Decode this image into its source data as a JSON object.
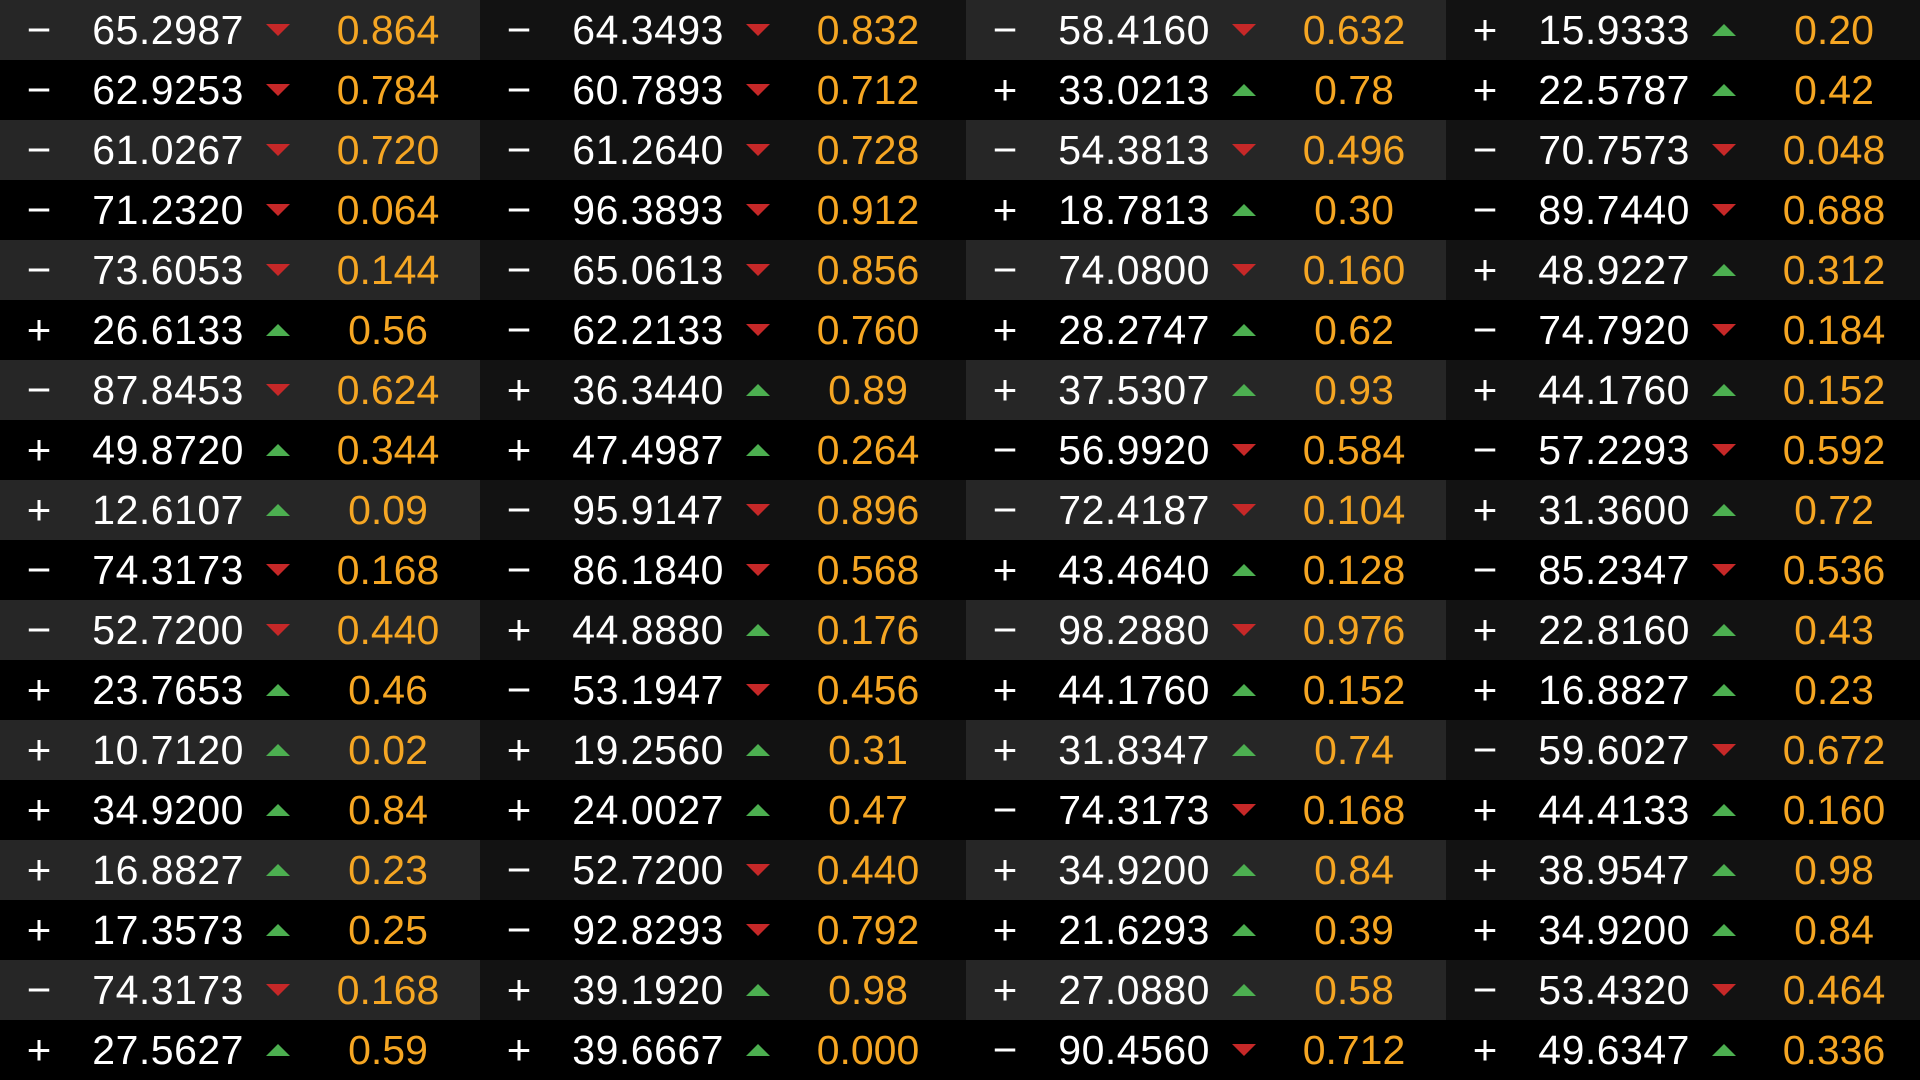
{
  "colors": {
    "row_dark": "#000000",
    "row_mid": "#121212",
    "row_light": "#262626",
    "up": "#4caf50",
    "down": "#c62828",
    "change_text": "#f5a623",
    "value_text": "#ffffff"
  },
  "icons": {
    "up": "triangle-up-icon",
    "down": "triangle-down-icon"
  },
  "columns": [
    {
      "rows": [
        {
          "sign": "−",
          "value": "65.2987",
          "dir": "down",
          "change": "0.864"
        },
        {
          "sign": "−",
          "value": "62.9253",
          "dir": "down",
          "change": "0.784"
        },
        {
          "sign": "−",
          "value": "61.0267",
          "dir": "down",
          "change": "0.720"
        },
        {
          "sign": "−",
          "value": "71.2320",
          "dir": "down",
          "change": "0.064"
        },
        {
          "sign": "−",
          "value": "73.6053",
          "dir": "down",
          "change": "0.144"
        },
        {
          "sign": "+",
          "value": "26.6133",
          "dir": "up",
          "change": "0.56"
        },
        {
          "sign": "−",
          "value": "87.8453",
          "dir": "down",
          "change": "0.624"
        },
        {
          "sign": "+",
          "value": "49.8720",
          "dir": "up",
          "change": "0.344"
        },
        {
          "sign": "+",
          "value": "12.6107",
          "dir": "up",
          "change": "0.09"
        },
        {
          "sign": "−",
          "value": "74.3173",
          "dir": "down",
          "change": "0.168"
        },
        {
          "sign": "−",
          "value": "52.7200",
          "dir": "down",
          "change": "0.440"
        },
        {
          "sign": "+",
          "value": "23.7653",
          "dir": "up",
          "change": "0.46"
        },
        {
          "sign": "+",
          "value": "10.7120",
          "dir": "up",
          "change": "0.02"
        },
        {
          "sign": "+",
          "value": "34.9200",
          "dir": "up",
          "change": "0.84"
        },
        {
          "sign": "+",
          "value": "16.8827",
          "dir": "up",
          "change": "0.23"
        },
        {
          "sign": "+",
          "value": "17.3573",
          "dir": "up",
          "change": "0.25"
        },
        {
          "sign": "−",
          "value": "74.3173",
          "dir": "down",
          "change": "0.168"
        },
        {
          "sign": "+",
          "value": "27.5627",
          "dir": "up",
          "change": "0.59"
        }
      ]
    },
    {
      "rows": [
        {
          "sign": "−",
          "value": "64.3493",
          "dir": "down",
          "change": "0.832"
        },
        {
          "sign": "−",
          "value": "60.7893",
          "dir": "down",
          "change": "0.712"
        },
        {
          "sign": "−",
          "value": "61.2640",
          "dir": "down",
          "change": "0.728"
        },
        {
          "sign": "−",
          "value": "96.3893",
          "dir": "down",
          "change": "0.912"
        },
        {
          "sign": "−",
          "value": "65.0613",
          "dir": "down",
          "change": "0.856"
        },
        {
          "sign": "−",
          "value": "62.2133",
          "dir": "down",
          "change": "0.760"
        },
        {
          "sign": "+",
          "value": "36.3440",
          "dir": "up",
          "change": "0.89"
        },
        {
          "sign": "+",
          "value": "47.4987",
          "dir": "up",
          "change": "0.264"
        },
        {
          "sign": "−",
          "value": "95.9147",
          "dir": "down",
          "change": "0.896"
        },
        {
          "sign": "−",
          "value": "86.1840",
          "dir": "down",
          "change": "0.568"
        },
        {
          "sign": "+",
          "value": "44.8880",
          "dir": "up",
          "change": "0.176"
        },
        {
          "sign": "−",
          "value": "53.1947",
          "dir": "down",
          "change": "0.456"
        },
        {
          "sign": "+",
          "value": "19.2560",
          "dir": "up",
          "change": "0.31"
        },
        {
          "sign": "+",
          "value": "24.0027",
          "dir": "up",
          "change": "0.47"
        },
        {
          "sign": "−",
          "value": "52.7200",
          "dir": "down",
          "change": "0.440"
        },
        {
          "sign": "−",
          "value": "92.8293",
          "dir": "down",
          "change": "0.792"
        },
        {
          "sign": "+",
          "value": "39.1920",
          "dir": "up",
          "change": "0.98"
        },
        {
          "sign": "+",
          "value": "39.6667",
          "dir": "up",
          "change": "0.000"
        }
      ]
    },
    {
      "rows": [
        {
          "sign": "−",
          "value": "58.4160",
          "dir": "down",
          "change": "0.632"
        },
        {
          "sign": "+",
          "value": "33.0213",
          "dir": "up",
          "change": "0.78"
        },
        {
          "sign": "−",
          "value": "54.3813",
          "dir": "down",
          "change": "0.496"
        },
        {
          "sign": "+",
          "value": "18.7813",
          "dir": "up",
          "change": "0.30"
        },
        {
          "sign": "−",
          "value": "74.0800",
          "dir": "down",
          "change": "0.160"
        },
        {
          "sign": "+",
          "value": "28.2747",
          "dir": "up",
          "change": "0.62"
        },
        {
          "sign": "+",
          "value": "37.5307",
          "dir": "up",
          "change": "0.93"
        },
        {
          "sign": "−",
          "value": "56.9920",
          "dir": "down",
          "change": "0.584"
        },
        {
          "sign": "−",
          "value": "72.4187",
          "dir": "down",
          "change": "0.104"
        },
        {
          "sign": "+",
          "value": "43.4640",
          "dir": "up",
          "change": "0.128"
        },
        {
          "sign": "−",
          "value": "98.2880",
          "dir": "down",
          "change": "0.976"
        },
        {
          "sign": "+",
          "value": "44.1760",
          "dir": "up",
          "change": "0.152"
        },
        {
          "sign": "+",
          "value": "31.8347",
          "dir": "up",
          "change": "0.74"
        },
        {
          "sign": "−",
          "value": "74.3173",
          "dir": "down",
          "change": "0.168"
        },
        {
          "sign": "+",
          "value": "34.9200",
          "dir": "up",
          "change": "0.84"
        },
        {
          "sign": "+",
          "value": "21.6293",
          "dir": "up",
          "change": "0.39"
        },
        {
          "sign": "+",
          "value": "27.0880",
          "dir": "up",
          "change": "0.58"
        },
        {
          "sign": "−",
          "value": "90.4560",
          "dir": "down",
          "change": "0.712"
        }
      ]
    },
    {
      "rows": [
        {
          "sign": "+",
          "value": "15.9333",
          "dir": "up",
          "change": "0.20"
        },
        {
          "sign": "+",
          "value": "22.5787",
          "dir": "up",
          "change": "0.42"
        },
        {
          "sign": "−",
          "value": "70.7573",
          "dir": "down",
          "change": "0.048"
        },
        {
          "sign": "−",
          "value": "89.7440",
          "dir": "down",
          "change": "0.688"
        },
        {
          "sign": "+",
          "value": "48.9227",
          "dir": "up",
          "change": "0.312"
        },
        {
          "sign": "−",
          "value": "74.7920",
          "dir": "down",
          "change": "0.184"
        },
        {
          "sign": "+",
          "value": "44.1760",
          "dir": "up",
          "change": "0.152"
        },
        {
          "sign": "−",
          "value": "57.2293",
          "dir": "down",
          "change": "0.592"
        },
        {
          "sign": "+",
          "value": "31.3600",
          "dir": "up",
          "change": "0.72"
        },
        {
          "sign": "−",
          "value": "85.2347",
          "dir": "down",
          "change": "0.536"
        },
        {
          "sign": "+",
          "value": "22.8160",
          "dir": "up",
          "change": "0.43"
        },
        {
          "sign": "+",
          "value": "16.8827",
          "dir": "up",
          "change": "0.23"
        },
        {
          "sign": "−",
          "value": "59.6027",
          "dir": "down",
          "change": "0.672"
        },
        {
          "sign": "+",
          "value": "44.4133",
          "dir": "up",
          "change": "0.160"
        },
        {
          "sign": "+",
          "value": "38.9547",
          "dir": "up",
          "change": "0.98"
        },
        {
          "sign": "+",
          "value": "34.9200",
          "dir": "up",
          "change": "0.84"
        },
        {
          "sign": "−",
          "value": "53.4320",
          "dir": "down",
          "change": "0.464"
        },
        {
          "sign": "+",
          "value": "49.6347",
          "dir": "up",
          "change": "0.336"
        }
      ]
    }
  ]
}
